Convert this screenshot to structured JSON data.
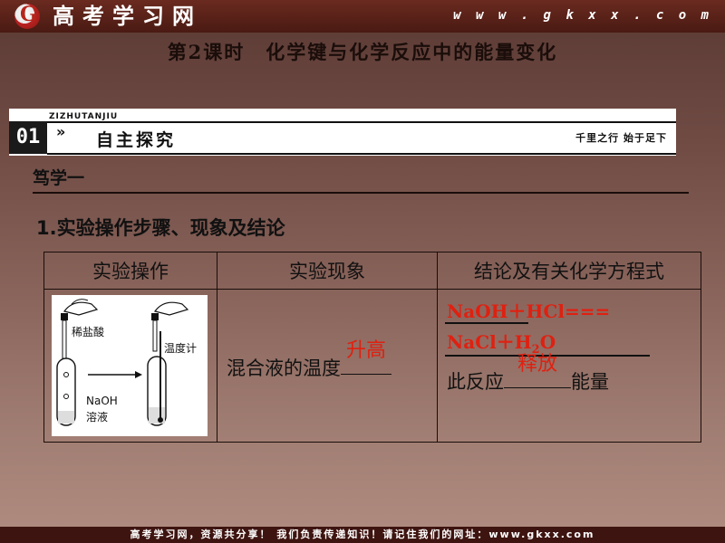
{
  "header": {
    "site_name": "高考学习网",
    "site_url": "w w w . g k x x . c o m",
    "logo_icon": "gkxx-logo-icon"
  },
  "lesson_title": "第2课时　化学键与化学反应中的能量变化",
  "banner": {
    "number": "01",
    "pinyin": "ZIZHUTANJIU",
    "arrow": "»",
    "title": "自主探究",
    "motto": "千里之行  始于足下"
  },
  "subsection": "笃学一",
  "heading": "1.实验操作步骤、现象及结论",
  "table": {
    "headers": [
      "实验操作",
      "实验现象",
      "结论及有关化学方程式"
    ],
    "diagram_labels": {
      "acid": "稀盐酸",
      "thermometer": "温度计",
      "naoh_line1": "NaOH",
      "naoh_line2": "溶液"
    },
    "phenomenon_text": "混合液的温度",
    "phenomenon_answer": "升高",
    "equation_line1": "NaOH＋HCl===",
    "equation_line2_prefix": "NaCl＋H",
    "equation_line2_sub": "2",
    "equation_line2_suffix": "O",
    "conclusion_prefix": "此反应",
    "conclusion_answer": "释放",
    "conclusion_suffix": "能量"
  },
  "footer": "高考学习网，资源共分享！  我们负责传递知识！请记住我们的网址：www.gkxx.com",
  "colors": {
    "answer_red": "#e02010",
    "header_bg": "#4a1a13"
  }
}
